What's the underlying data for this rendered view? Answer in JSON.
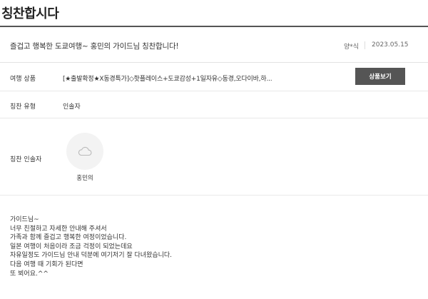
{
  "page": {
    "title": "칭찬합시다"
  },
  "post": {
    "title": "즐겁고 행복한 도쿄여행~ 홍민의 가이드님 칭찬합니다!",
    "author": "양*식",
    "date": "2023.05.15"
  },
  "product": {
    "label": "여행 상품",
    "value": "[★출발확정★X동경특가]◇핫플레이스+도쿄감성+1일자유◇동경,오다이바,하...",
    "button_label": "상품보기"
  },
  "praise_type": {
    "label": "칭찬 유형",
    "value": "인솔자"
  },
  "praised_person": {
    "label": "칭찬 인솔자",
    "name": "홍민의",
    "avatar_icon": "cloud-icon"
  },
  "body": {
    "lines": [
      "가이드님~",
      "너무 친절하고 자세한 안내해 주셔서",
      "가족과 함께 즐겁고 행복한 여정이었습니다.",
      "일본 여행이 처음이라 조금 걱정이 되었는데요",
      "자유일정도 가이드님 안내 덕분에 여기저기 잘 다녀왔습니다.",
      "다음 여행 때 기회가 된다면",
      "또 뵈어요.^^"
    ]
  },
  "colors": {
    "button_bg": "#555555",
    "rule": "#555555",
    "avatar_bg": "#f3f3f3"
  }
}
